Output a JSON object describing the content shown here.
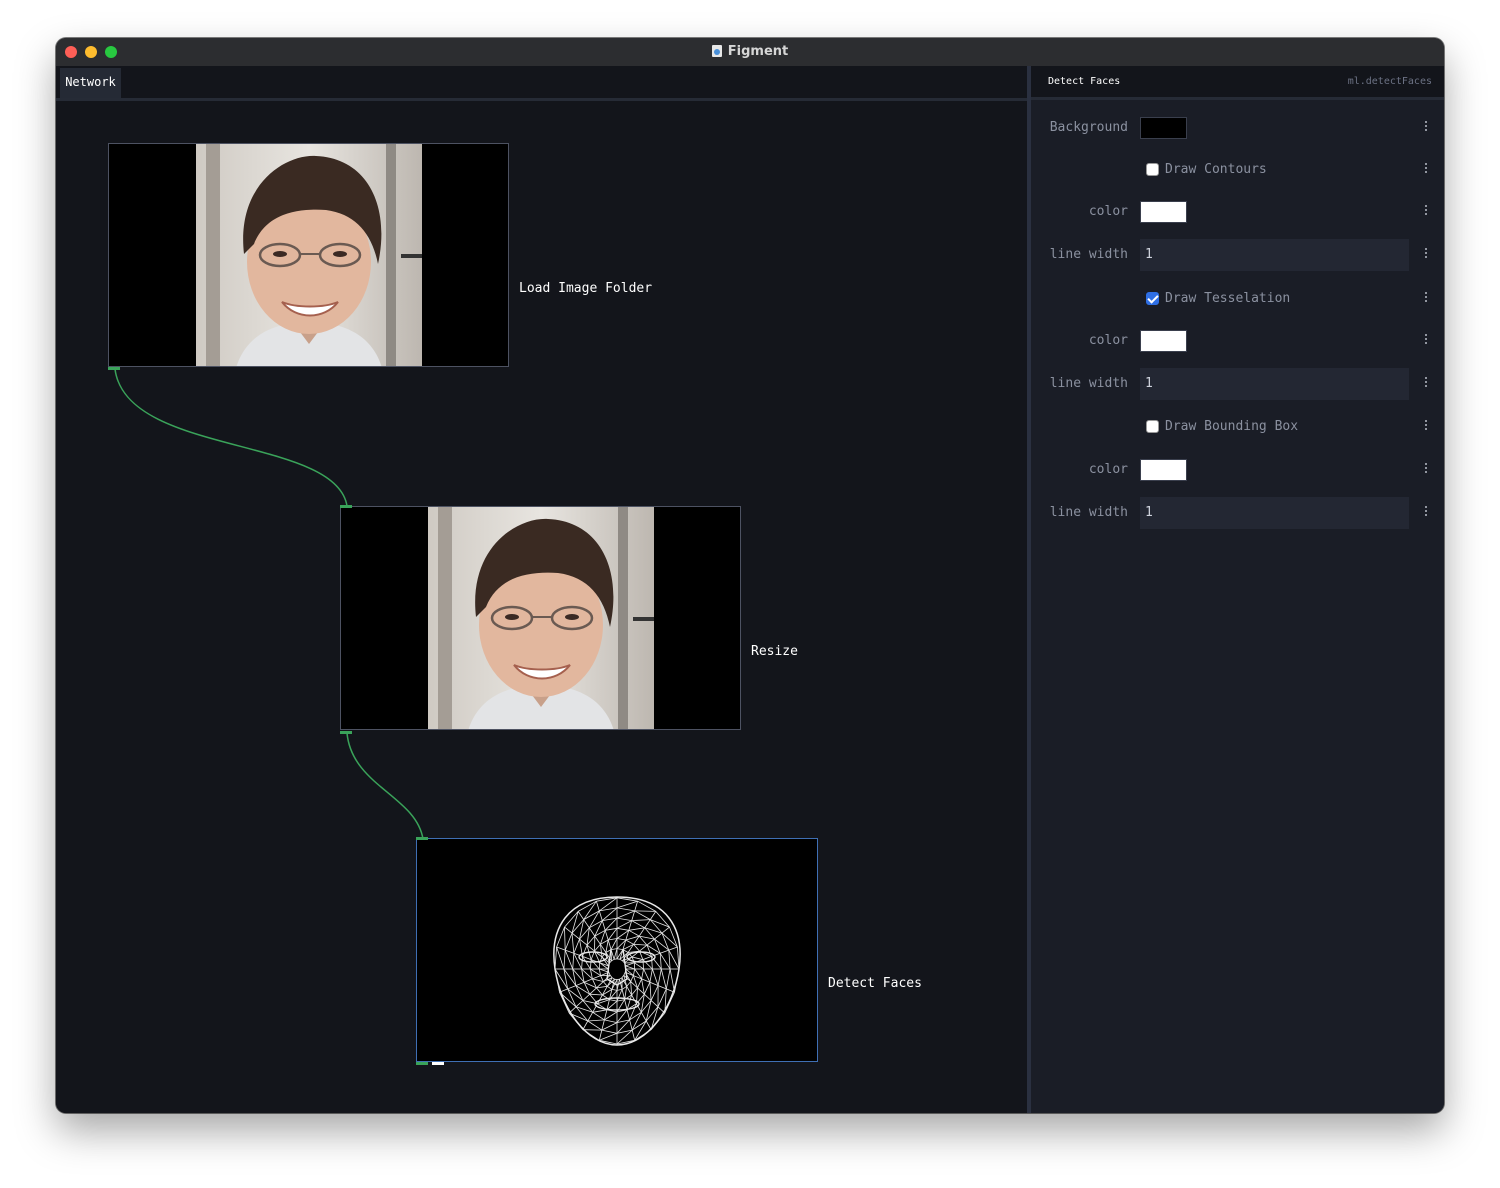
{
  "window": {
    "title": "Figment"
  },
  "network": {
    "tab_label": "Network",
    "nodes": [
      {
        "label": "Load Image Folder"
      },
      {
        "label": "Resize"
      },
      {
        "label": "Detect Faces"
      }
    ]
  },
  "parameters": {
    "node_title": "Detect Faces",
    "node_type": "ml.detectFaces",
    "rows": [
      {
        "kind": "color",
        "label": "Background",
        "value": "#000000"
      },
      {
        "kind": "checkbox",
        "label": "Draw Contours",
        "checked": false
      },
      {
        "kind": "color",
        "label": "color",
        "value": "#ffffff"
      },
      {
        "kind": "number",
        "label": "line width",
        "value": "1"
      },
      {
        "kind": "checkbox",
        "label": "Draw Tesselation",
        "checked": true
      },
      {
        "kind": "color",
        "label": "color",
        "value": "#ffffff"
      },
      {
        "kind": "number",
        "label": "line width",
        "value": "1"
      },
      {
        "kind": "checkbox",
        "label": "Draw Bounding Box",
        "checked": false
      },
      {
        "kind": "color",
        "label": "color",
        "value": "#ffffff"
      },
      {
        "kind": "number",
        "label": "line width",
        "value": "1"
      }
    ]
  },
  "colors": {
    "connection": "#3aa35a",
    "selection_border": "#3f6fb4",
    "checkbox_checked": "#2f6fe4"
  }
}
